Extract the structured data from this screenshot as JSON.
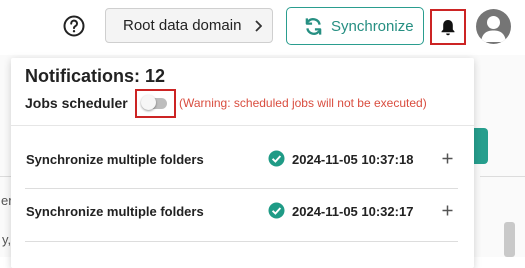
{
  "header": {
    "help_icon": "help-circle-icon",
    "domain_label": "Root data domain",
    "sync_label": "Synchronize",
    "colors": {
      "accent": "#2a9d8f",
      "highlight": "#cc2424"
    }
  },
  "notifications": {
    "title": "Notifications: 12",
    "jobs_scheduler_label": "Jobs scheduler",
    "jobs_scheduler_enabled": false,
    "warning": "(Warning: scheduled jobs will not be executed)",
    "items": [
      {
        "title": "Synchronize multiple folders",
        "status": "success",
        "timestamp": "2024-11-05 10:37:18"
      },
      {
        "title": "Synchronize multiple folders",
        "status": "success",
        "timestamp": "2024-11-05 10:32:17"
      }
    ]
  },
  "background": {
    "fragment_1": "er",
    "fragment_2": "y,"
  }
}
